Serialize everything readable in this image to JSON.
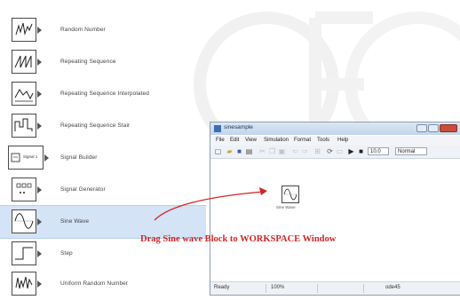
{
  "library": {
    "items": [
      {
        "label": "Random Number",
        "icon": "random-number-icon"
      },
      {
        "label": "Repeating Sequence",
        "icon": "repeating-sequence-icon"
      },
      {
        "label": "Repeating Sequence Interpolated",
        "icon": "repeating-sequence-interpolated-icon"
      },
      {
        "label": "Repeating Sequence Stair",
        "icon": "repeating-sequence-stair-icon"
      },
      {
        "label": "Signal Builder",
        "icon": "signal-builder-icon",
        "block_text": "Signal 1"
      },
      {
        "label": "Signal Generator",
        "icon": "signal-generator-icon"
      },
      {
        "label": "Sine Wave",
        "icon": "sine-wave-icon",
        "selected": true
      },
      {
        "label": "Step",
        "icon": "step-icon"
      },
      {
        "label": "Uniform Random Number",
        "icon": "uniform-random-number-icon"
      }
    ]
  },
  "window": {
    "title": "sinesample",
    "menu": [
      "File",
      "Edit",
      "View",
      "Simulation",
      "Format",
      "Tools",
      "Help"
    ],
    "stop_time": "10.0",
    "sim_mode": "Normal",
    "canvas_block_label": "Sine Wave",
    "status": {
      "state": "Ready",
      "zoom": "100%",
      "solver": "ode45"
    }
  },
  "annotation": {
    "caption": "Drag Sine wave Block to WORKSPACE Window",
    "color": "#d42525"
  }
}
